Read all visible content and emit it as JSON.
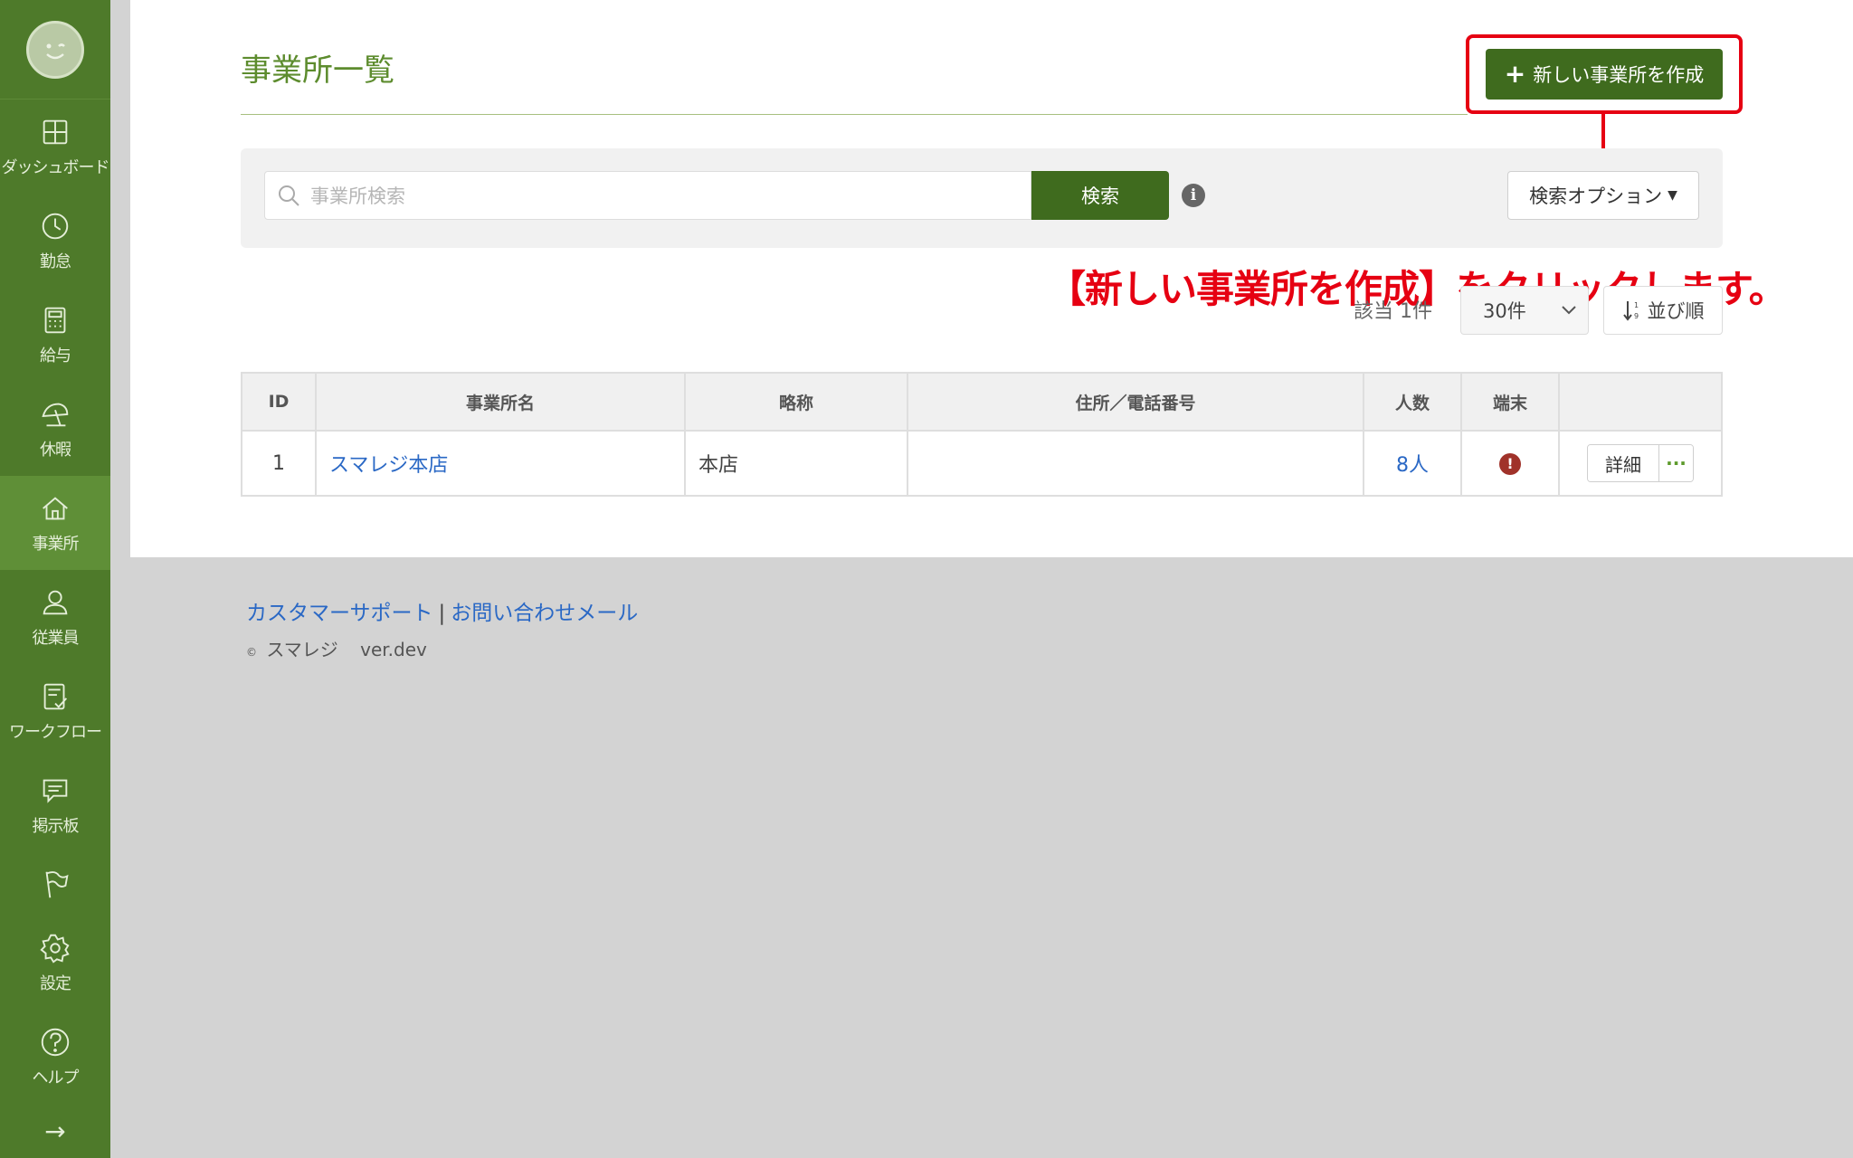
{
  "sidebar": {
    "items": [
      {
        "label": "ダッシュボード",
        "icon": "dashboard-icon"
      },
      {
        "label": "勤怠",
        "icon": "clock-icon"
      },
      {
        "label": "給与",
        "icon": "calculator-icon"
      },
      {
        "label": "休暇",
        "icon": "parasol-icon"
      },
      {
        "label": "事業所",
        "icon": "home-icon",
        "active": true
      },
      {
        "label": "従業員",
        "icon": "person-icon"
      },
      {
        "label": "ワークフロー",
        "icon": "clipboard-check-icon"
      },
      {
        "label": "掲示板",
        "icon": "chat-icon"
      }
    ],
    "bottom_items": [
      {
        "label": "設定",
        "icon": "gear-icon"
      },
      {
        "label": "ヘルプ",
        "icon": "help-icon"
      }
    ],
    "expand_arrow": "→"
  },
  "header": {
    "title": "事業所一覧",
    "create_button_label": "新しい事業所を作成"
  },
  "annotation": {
    "text": "【新しい事業所を作成】をクリックします。",
    "color": "#e60012"
  },
  "search": {
    "placeholder": "事業所検索",
    "button_label": "検索",
    "info_symbol": "i",
    "options_label": "検索オプション"
  },
  "results": {
    "count_text": "該当 1件",
    "per_page": "30件",
    "sort_label": "並び順"
  },
  "table": {
    "columns": [
      "ID",
      "事業所名",
      "略称",
      "住所／電話番号",
      "人数",
      "端末",
      ""
    ],
    "rows": [
      {
        "id": "1",
        "name": "スマレジ本店",
        "abbr": "本店",
        "address": "",
        "people": "8人",
        "terminal_status": "!",
        "detail_label": "詳細",
        "more_label": "···"
      }
    ]
  },
  "footer": {
    "support_link": "カスタマーサポート",
    "separator": "|",
    "contact_link": "お問い合わせメール",
    "copyright_symbol": "©",
    "brand": "スマレジ",
    "version": "ver.dev"
  },
  "colors": {
    "sidebar_bg": "#4e7a2a",
    "primary_button": "#3f6b1e",
    "title_green": "#5d8c2e",
    "link_blue": "#2a68c5",
    "annotation_red": "#e60012"
  }
}
